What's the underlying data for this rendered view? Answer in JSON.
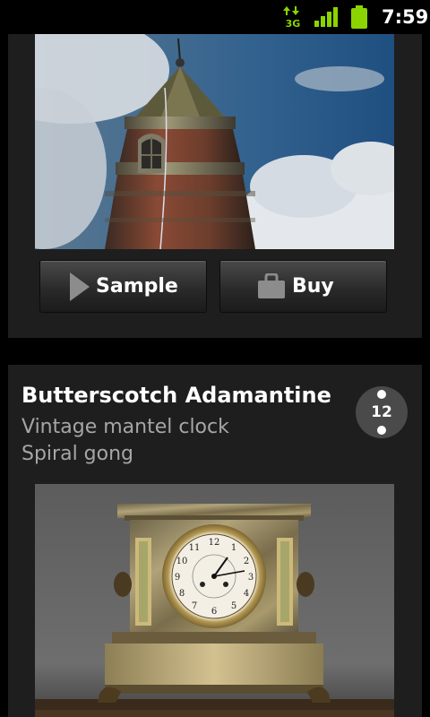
{
  "status_bar": {
    "network_type": "3G",
    "time": "7:59",
    "icons": [
      "data-transfer-icon",
      "signal-strength-icon",
      "battery-icon"
    ]
  },
  "cards": [
    {
      "image": "tower-photo",
      "actions": {
        "sample_label": "Sample",
        "buy_label": "Buy",
        "sample_icon": "play-icon",
        "buy_icon": "shopping-bag-icon"
      }
    },
    {
      "title": "Butterscotch Adamantine",
      "subtitle_1": "Vintage mantel clock",
      "subtitle_2": "Spiral gong",
      "badge": "12",
      "image": "mantel-clock-photo"
    }
  ],
  "colors": {
    "card_background": "#1e1e1e",
    "title_text": "#ffffff",
    "subtitle_text": "#a6a6a6",
    "status_green": "#8cd400"
  }
}
